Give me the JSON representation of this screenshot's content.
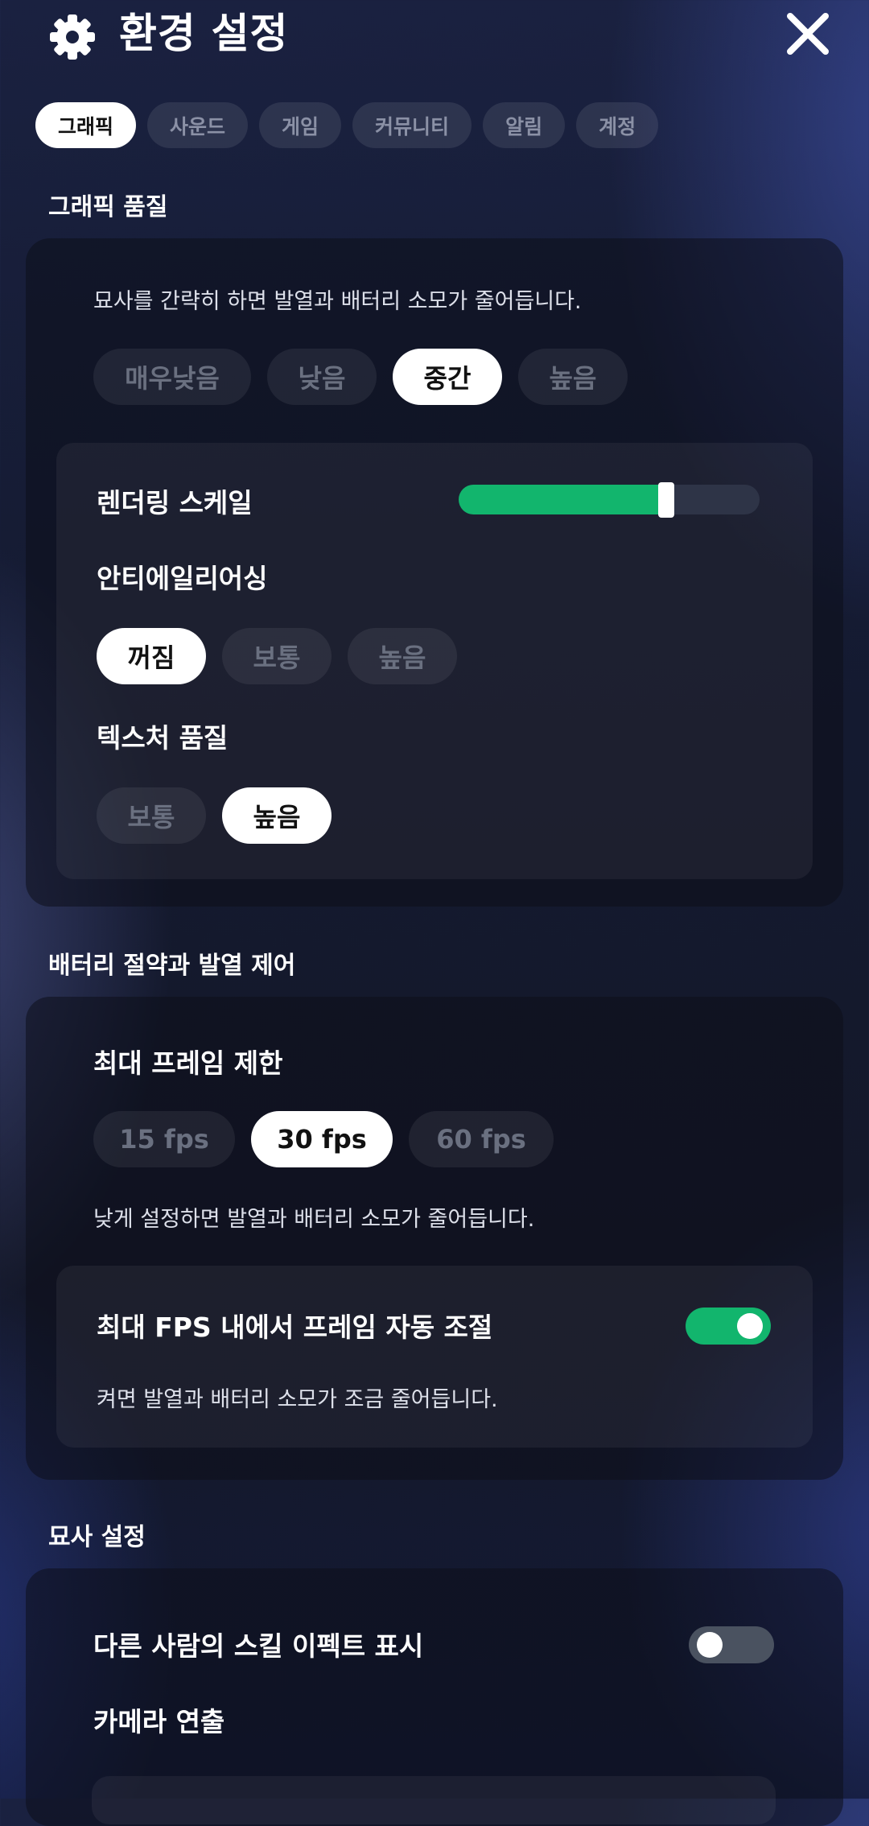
{
  "header": {
    "title": "환경 설정"
  },
  "tabs": [
    {
      "label": "그래픽",
      "active": true
    },
    {
      "label": "사운드",
      "active": false
    },
    {
      "label": "게임",
      "active": false
    },
    {
      "label": "커뮤니티",
      "active": false
    },
    {
      "label": "알림",
      "active": false
    },
    {
      "label": "계정",
      "active": false
    }
  ],
  "graphics": {
    "section_title": "그래픽 품질",
    "description": "묘사를 간략히 하면 발열과 배터리 소모가 줄어듭니다.",
    "quality_options": [
      "매우낮음",
      "낮음",
      "중간",
      "높음"
    ],
    "quality_selected": "중간",
    "render_scale_label": "렌더링 스케일",
    "render_scale_value": 0.69,
    "antialiasing_label": "안티에일리어싱",
    "antialiasing_options": [
      "꺼짐",
      "보통",
      "높음"
    ],
    "antialiasing_selected": "꺼짐",
    "texture_label": "텍스처 품질",
    "texture_options": [
      "보통",
      "높음"
    ],
    "texture_selected": "높음"
  },
  "battery": {
    "section_title": "배터리 절약과 발열 제어",
    "fps_label": "최대 프레임 제한",
    "fps_options": [
      "15 fps",
      "30 fps",
      "60 fps"
    ],
    "fps_selected": "30 fps",
    "fps_description": "낮게 설정하면 발열과 배터리 소모가 줄어듭니다.",
    "auto_label": "최대 FPS 내에서 프레임 자동 조절",
    "auto_description": "켜면 발열과 배터리 소모가 조금 줄어듭니다.",
    "auto_enabled": true
  },
  "render": {
    "section_title": "묘사 설정",
    "skill_effect_label": "다른 사람의 스킬 이펙트 표시",
    "skill_effect_enabled": false,
    "camera_label": "카메라 연출"
  },
  "colors": {
    "accent": "#12b56d",
    "toggle_off": "#4a5260"
  }
}
